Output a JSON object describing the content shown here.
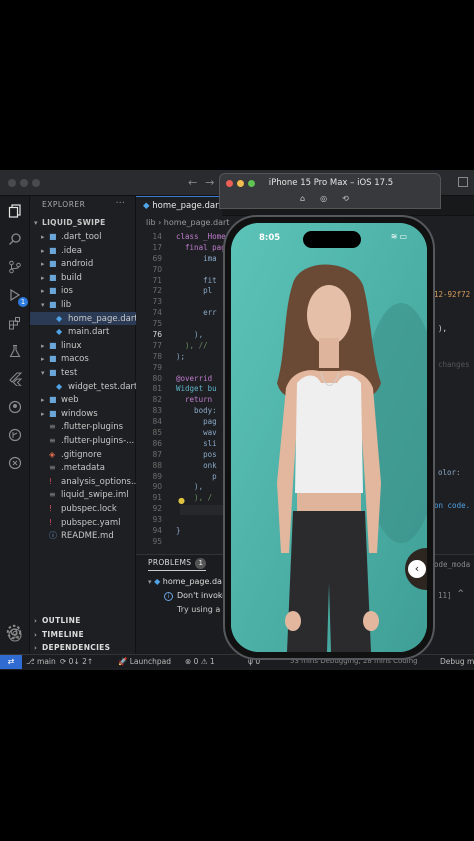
{
  "vscode": {
    "sidebar": {
      "header": "EXPLORER",
      "more": "···",
      "root": "LIQUID_SWIPE",
      "items": [
        {
          "label": ".dart_tool",
          "type": "folder",
          "indent": 1
        },
        {
          "label": ".idea",
          "type": "folder",
          "indent": 1
        },
        {
          "label": "android",
          "type": "folder",
          "indent": 1
        },
        {
          "label": "build",
          "type": "folder",
          "indent": 1
        },
        {
          "label": "ios",
          "type": "folder",
          "indent": 1
        },
        {
          "label": "lib",
          "type": "folder-open",
          "indent": 1
        },
        {
          "label": "home_page.dart",
          "type": "dart",
          "indent": 2,
          "selected": true
        },
        {
          "label": "main.dart",
          "type": "dart",
          "indent": 2
        },
        {
          "label": "linux",
          "type": "folder",
          "indent": 1
        },
        {
          "label": "macos",
          "type": "folder",
          "indent": 1
        },
        {
          "label": "test",
          "type": "folder-open",
          "indent": 1
        },
        {
          "label": "widget_test.dart",
          "type": "dart",
          "indent": 2
        },
        {
          "label": "web",
          "type": "folder",
          "indent": 1
        },
        {
          "label": "windows",
          "type": "folder",
          "indent": 1
        },
        {
          "label": ".flutter-plugins",
          "type": "file",
          "indent": 1
        },
        {
          "label": ".flutter-plugins-...",
          "type": "file",
          "indent": 1
        },
        {
          "label": ".gitignore",
          "type": "git",
          "indent": 1
        },
        {
          "label": ".metadata",
          "type": "file",
          "indent": 1
        },
        {
          "label": "analysis_options...",
          "type": "yaml",
          "indent": 1
        },
        {
          "label": "liquid_swipe.iml",
          "type": "file",
          "indent": 1
        },
        {
          "label": "pubspec.lock",
          "type": "yaml",
          "indent": 1
        },
        {
          "label": "pubspec.yaml",
          "type": "yaml",
          "indent": 1
        },
        {
          "label": "README.md",
          "type": "md",
          "indent": 1
        }
      ],
      "sections": [
        "OUTLINE",
        "TIMELINE",
        "DEPENDENCIES"
      ]
    },
    "tab": {
      "label": "home_page.dart"
    },
    "breadcrumb": "lib › home_page.dart",
    "line_numbers": [
      "14",
      "17",
      "69",
      "70",
      "71",
      "72",
      "73",
      "74",
      "75",
      "76",
      "77",
      "78",
      "79",
      "80",
      "81",
      "82",
      "83",
      "84",
      "85",
      "86",
      "87",
      "88",
      "89",
      "90",
      "91",
      "92",
      "93",
      "94",
      "95"
    ],
    "code_lines": [
      "class _Home",
      "  final pag",
      "      ima",
      "",
      "      fit",
      "      pl",
      "",
      "      err",
      "",
      "    ),",
      "  ), //",
      ");",
      "",
      "@overrid",
      "Widget bu",
      "  return",
      "    body:",
      "      pag",
      "      wav",
      "      sli",
      "      pos",
      "      onk",
      "        p",
      "    ),",
      "    ), /",
      "  ); //",
      "",
      "}",
      ""
    ],
    "right_fragments": {
      "hex": "12-92f72",
      "paren": "),",
      "changes": "changes",
      "color": "olor:",
      "on_code": "on code.",
      "ode_moda": "ode_moda",
      "bracket": "11]"
    },
    "panel": {
      "tab": "PROBLEMS",
      "count": "1",
      "file": "home_page.da",
      "msg1": "Don't invoke",
      "msg2": "Try using a le"
    },
    "status": {
      "branch": "main",
      "sync": "0↓ 2↑",
      "launchpad": "Launchpad",
      "errors": "⊗ 0 ⚠ 1",
      "ports": "0",
      "time": "53 mins Debugging, 28 mins Coding",
      "debug": "Debug my"
    }
  },
  "simulator": {
    "title": "iPhone 15 Pro Max – iOS 17.5",
    "time": "8:05"
  },
  "colors": {
    "accent": "#2f6bd1",
    "screen_bg": "#52b7ae"
  }
}
